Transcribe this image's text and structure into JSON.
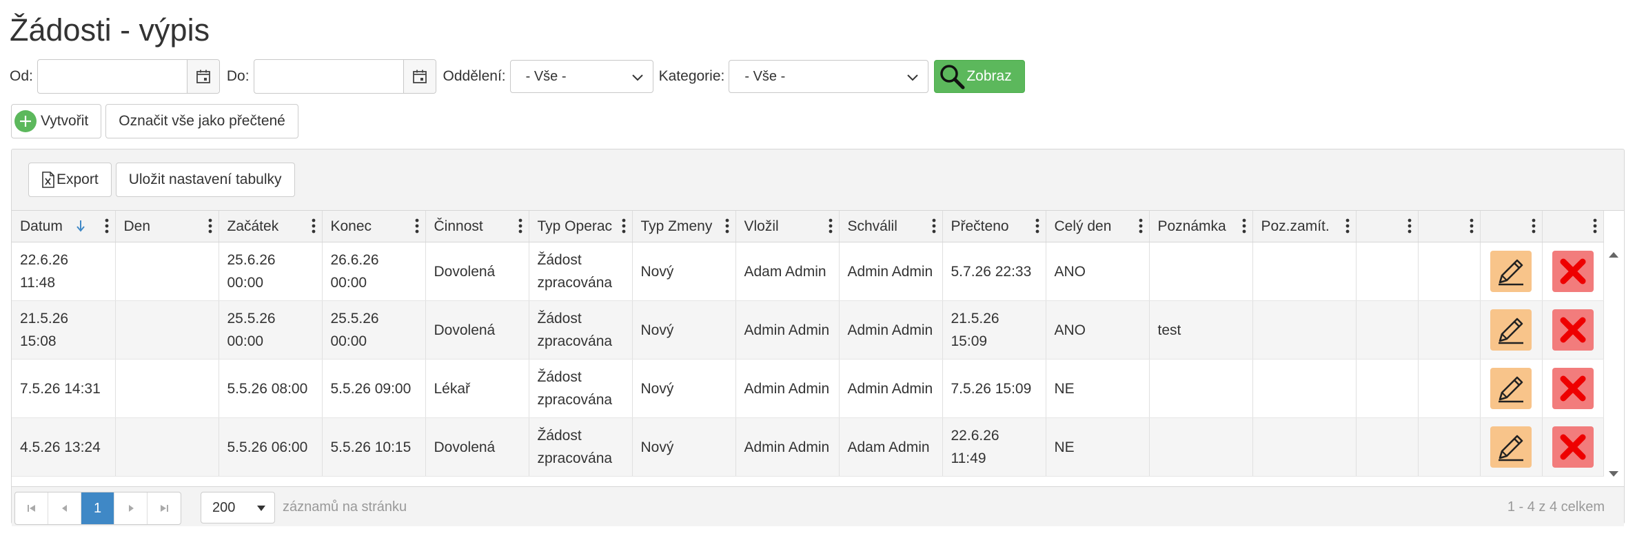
{
  "title": "Žádosti - výpis",
  "filters": {
    "od_label": "Od:",
    "od_value": "",
    "do_label": "Do:",
    "do_value": "",
    "oddeleni_label": "Oddělení:",
    "oddeleni_value": "- Vše -",
    "kategorie_label": "Kategorie:",
    "kategorie_value": "- Vše -",
    "zobraz_label": "Zobraz"
  },
  "actions": {
    "create_label": "Vytvořit",
    "mark_read_label": "Označit vše jako přečtené"
  },
  "toolbar": {
    "export_label": "Export",
    "save_settings_label": "Uložit nastavení tabulky"
  },
  "table": {
    "columns": [
      "Datum",
      "Den",
      "Začátek",
      "Konec",
      "Činnost",
      "Typ Operac",
      "Typ Zmeny",
      "Vložil",
      "Schválil",
      "Přečteno",
      "Celý den",
      "Poznámka",
      "Poz.zamít.",
      "",
      "",
      "",
      ""
    ],
    "rows": [
      [
        "22.6.26\n11:48",
        "",
        "25.6.26\n00:00",
        "26.6.26\n00:00",
        "Dovolená",
        "Žádost\nzpracována",
        "Nový",
        "Adam Admin",
        "Admin Admin",
        "5.7.26 22:33",
        "ANO",
        "",
        ""
      ],
      [
        "21.5.26\n15:08",
        "",
        "25.5.26\n00:00",
        "25.5.26\n00:00",
        "Dovolená",
        "Žádost\nzpracována",
        "Nový",
        "Admin Admin",
        "Admin Admin",
        "21.5.26\n15:09",
        "ANO",
        "test",
        ""
      ],
      [
        "7.5.26 14:31",
        "",
        "5.5.26 08:00",
        "5.5.26 09:00",
        "Lékař",
        "Žádost\nzpracována",
        "Nový",
        "Admin Admin",
        "Admin Admin",
        "7.5.26 15:09",
        "NE",
        "",
        ""
      ],
      [
        "4.5.26 13:24",
        "",
        "5.5.26 06:00",
        "5.5.26 10:15",
        "Dovolená",
        "Žádost\nzpracována",
        "Nový",
        "Admin Admin",
        "Adam Admin",
        "22.6.26\n11:49",
        "NE",
        "",
        ""
      ]
    ]
  },
  "pager": {
    "current_page": "1",
    "page_size": "200",
    "page_size_label": "záznamů na stránku",
    "info": "1 - 4 z 4 celkem"
  },
  "colors": {
    "accent_green": "#5cb85c",
    "page_active": "#3f88c6",
    "edit_bg": "#f8c48a",
    "delete_bg": "#f27c7c",
    "sort_arrow": "#3f88c6"
  },
  "icons": {
    "date_picker": "calendar-icon",
    "dropdown": "chevron-down-icon",
    "search": "search-icon",
    "create": "plus-circle-icon",
    "export": "excel-file-icon",
    "column_menu": "vertical-dots-icon",
    "sort": "sort-down-arrow-icon",
    "edit": "pencil-icon",
    "delete": "x-delete-icon"
  }
}
